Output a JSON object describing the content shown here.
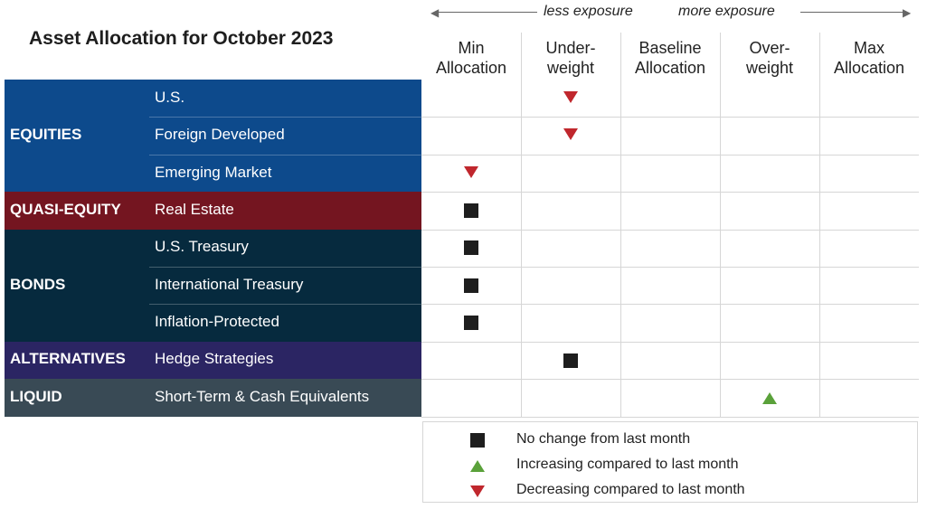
{
  "title": "Asset Allocation for October 2023",
  "exposure": {
    "less": "less exposure",
    "more": "more exposure"
  },
  "columns": [
    {
      "line1": "Min",
      "line2": "Allocation"
    },
    {
      "line1": "Under-",
      "line2": "weight"
    },
    {
      "line1": "Baseline",
      "line2": "Allocation"
    },
    {
      "line1": "Over-",
      "line2": "weight"
    },
    {
      "line1": "Max",
      "line2": "Allocation"
    }
  ],
  "groups": [
    {
      "label": "EQUITIES",
      "color": "#0d4a8c",
      "rows": [
        "U.S.",
        "Foreign Developed",
        "Emerging Market"
      ]
    },
    {
      "label": "QUASI-EQUITY",
      "color": "#741520",
      "rows": [
        "Real Estate"
      ]
    },
    {
      "label": "BONDS",
      "color": "#062a3e",
      "rows": [
        "U.S. Treasury",
        "International Treasury",
        "Inflation-Protected"
      ]
    },
    {
      "label": "ALTERNATIVES",
      "color": "#2b2563",
      "rows": [
        "Hedge Strategies"
      ]
    },
    {
      "label": "LIQUID",
      "color": "#394a55",
      "rows": [
        "Short-Term & Cash Equivalents"
      ]
    }
  ],
  "legend": [
    {
      "symbol": "square",
      "label": "No change from last month"
    },
    {
      "symbol": "up",
      "label": "Increasing compared to last month"
    },
    {
      "symbol": "down",
      "label": "Decreasing compared to last month"
    }
  ],
  "colors": {
    "decrease": "#c0272d",
    "increase": "#5aa13a",
    "no_change": "#1e1e1e"
  },
  "chart_data": {
    "type": "table",
    "title": "Asset Allocation for October 2023",
    "categories": [
      "Min Allocation",
      "Under-weight",
      "Baseline Allocation",
      "Over-weight",
      "Max Allocation"
    ],
    "rows": [
      {
        "group": "EQUITIES",
        "asset": "U.S.",
        "position": "Under-weight",
        "change": "decreasing"
      },
      {
        "group": "EQUITIES",
        "asset": "Foreign Developed",
        "position": "Under-weight",
        "change": "decreasing"
      },
      {
        "group": "EQUITIES",
        "asset": "Emerging Market",
        "position": "Min Allocation",
        "change": "decreasing"
      },
      {
        "group": "QUASI-EQUITY",
        "asset": "Real Estate",
        "position": "Min Allocation",
        "change": "no change"
      },
      {
        "group": "BONDS",
        "asset": "U.S. Treasury",
        "position": "Min Allocation",
        "change": "no change"
      },
      {
        "group": "BONDS",
        "asset": "International Treasury",
        "position": "Min Allocation",
        "change": "no change"
      },
      {
        "group": "BONDS",
        "asset": "Inflation-Protected",
        "position": "Min Allocation",
        "change": "no change"
      },
      {
        "group": "ALTERNATIVES",
        "asset": "Hedge Strategies",
        "position": "Under-weight",
        "change": "no change"
      },
      {
        "group": "LIQUID",
        "asset": "Short-Term & Cash Equivalents",
        "position": "Over-weight",
        "change": "increasing"
      }
    ]
  }
}
